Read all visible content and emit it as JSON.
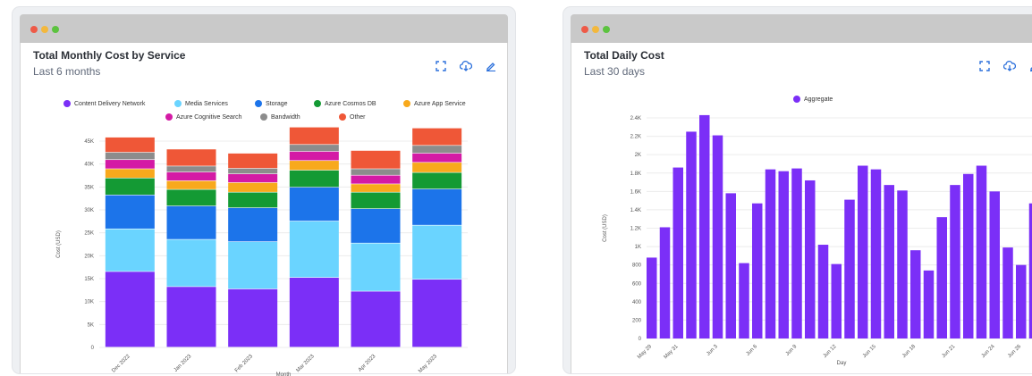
{
  "cost_by_service": {
    "title": "Total Monthly Cost by Service",
    "subtitle": "Last 6 months",
    "toolbar": {
      "expand_icon": "expand-icon",
      "download_icon": "download-icon",
      "edit_icon": "edit-icon"
    },
    "legend": [
      {
        "label": "Content Delivery Network",
        "color": "#7b2ff7"
      },
      {
        "label": "Media Services",
        "color": "#6ad4ff"
      },
      {
        "label": "Storage",
        "color": "#1c74ea"
      },
      {
        "label": "Azure Cosmos DB",
        "color": "#149a34"
      },
      {
        "label": "Azure App Service",
        "color": "#f8a91c"
      },
      {
        "label": "Azure Cognitive Search",
        "color": "#d41aa5"
      },
      {
        "label": "Bandwidth",
        "color": "#8c8c8c"
      },
      {
        "label": "Other",
        "color": "#ef5737"
      }
    ]
  },
  "daily_cost": {
    "title": "Total Daily Cost",
    "subtitle": "Last 30 days",
    "toolbar": {
      "expand_icon": "expand-icon",
      "download_icon": "download-icon",
      "edit_icon": "edit-icon"
    },
    "legend": [
      {
        "label": "Aggregate",
        "color": "#7b2ff7"
      }
    ]
  },
  "chart_data": [
    {
      "type": "bar",
      "stacked": true,
      "categories": [
        "Dec 2022",
        "Jan 2023",
        "Feb 2023",
        "Mar 2023",
        "Apr 2023",
        "May 2023"
      ],
      "xlabel": "Month",
      "ylabel": "Cost (USD)",
      "ylim": [
        0,
        45000
      ],
      "yticks": [
        "0",
        "5K",
        "10K",
        "15K",
        "20K",
        "25K",
        "30K",
        "35K",
        "40K",
        "45K"
      ],
      "grid": true,
      "legend_position": "top",
      "series": [
        {
          "name": "Content Delivery Network",
          "color": "#7b2ff7",
          "values": [
            16500,
            13200,
            12700,
            15200,
            12200,
            14800
          ]
        },
        {
          "name": "Media Services",
          "color": "#6ad4ff",
          "values": [
            9300,
            10300,
            10300,
            12300,
            10500,
            11800
          ]
        },
        {
          "name": "Storage",
          "color": "#1c74ea",
          "values": [
            7400,
            7300,
            7400,
            7400,
            7500,
            7900
          ]
        },
        {
          "name": "Azure Cosmos DB",
          "color": "#149a34",
          "values": [
            3700,
            3600,
            3400,
            3700,
            3600,
            3600
          ]
        },
        {
          "name": "Azure App Service",
          "color": "#f8a91c",
          "values": [
            2000,
            1900,
            2100,
            2100,
            1800,
            2200
          ]
        },
        {
          "name": "Azure Cognitive Search",
          "color": "#d41aa5",
          "values": [
            2000,
            1900,
            1900,
            2000,
            1900,
            2000
          ]
        },
        {
          "name": "Bandwidth",
          "color": "#8c8c8c",
          "values": [
            1600,
            1300,
            1200,
            1500,
            1400,
            1700
          ]
        },
        {
          "name": "Other",
          "color": "#ef5737",
          "values": [
            3300,
            3700,
            3300,
            3800,
            4000,
            3800
          ]
        }
      ]
    },
    {
      "type": "bar",
      "categories": [
        "May 29",
        "May 30",
        "May 31",
        "Jun 1",
        "Jun 2",
        "Jun 3",
        "Jun 4",
        "Jun 5",
        "Jun 6",
        "Jun 7",
        "Jun 8",
        "Jun 9",
        "Jun 10",
        "Jun 11",
        "Jun 12",
        "Jun 13",
        "Jun 14",
        "Jun 15",
        "Jun 16",
        "Jun 17",
        "Jun 18",
        "Jun 19",
        "Jun 20",
        "Jun 21",
        "Jun 22",
        "Jun 23",
        "Jun 24",
        "Jun 25",
        "Jun 26"
      ],
      "x_tick_labels": [
        "May 29",
        "May 31",
        "Jun 3",
        "Jun 6",
        "Jun 9",
        "Jun 12",
        "Jun 15",
        "Jun 18",
        "Jun 21",
        "Jun 24",
        "Jun 26"
      ],
      "xlabel": "Day",
      "ylabel": "Cost (USD)",
      "ylim": [
        0,
        2400
      ],
      "yticks": [
        "0",
        "200",
        "400",
        "600",
        "800",
        "1K",
        "1.2K",
        "1.4K",
        "1.6K",
        "1.8K",
        "2K",
        "2.2K",
        "2.4K"
      ],
      "grid": true,
      "legend_position": "top",
      "series": [
        {
          "name": "Aggregate",
          "color": "#7b2ff7",
          "values": [
            880,
            1210,
            1860,
            2250,
            2430,
            2210,
            1580,
            820,
            1470,
            1840,
            1820,
            1850,
            1720,
            1020,
            810,
            1510,
            1880,
            1840,
            1670,
            1610,
            960,
            740,
            1320,
            1670,
            1790,
            1880,
            1600,
            990,
            800,
            1470
          ]
        }
      ]
    }
  ]
}
